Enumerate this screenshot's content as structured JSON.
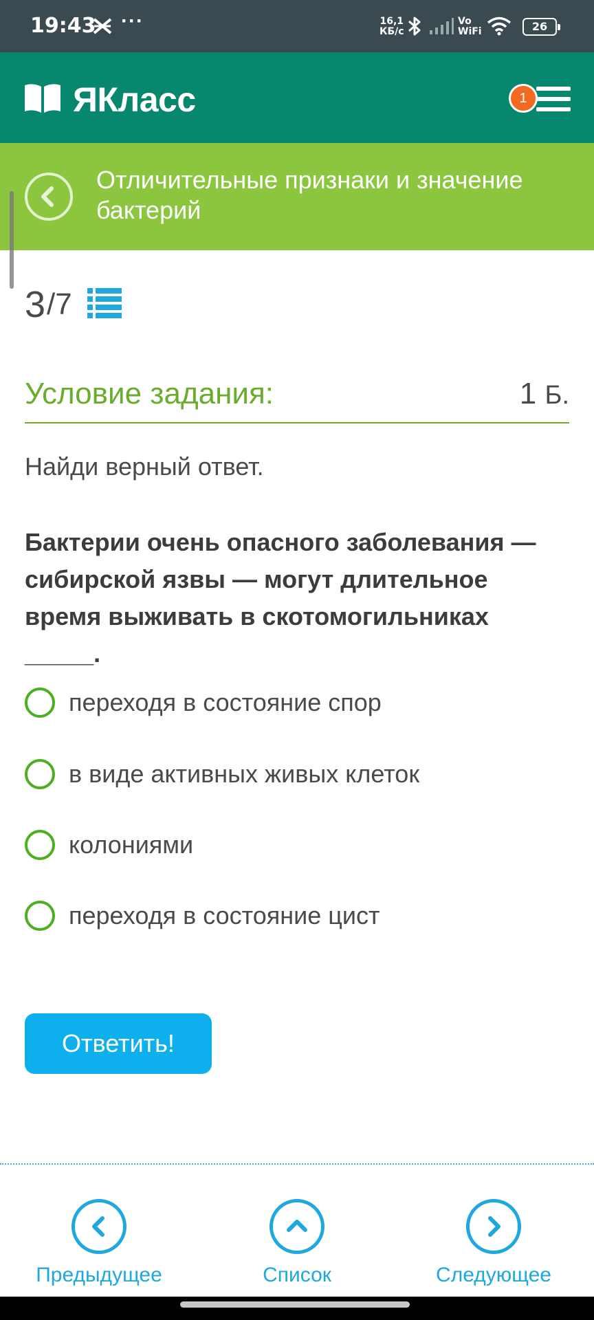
{
  "status_bar": {
    "time": "19:43",
    "dots": "···",
    "speed_value": "16,1",
    "speed_unit": "КБ/с",
    "vo": "Vo",
    "wifi_label": "WiFi",
    "battery": "26"
  },
  "app": {
    "logo_text": "ЯКласс",
    "notification_count": "1"
  },
  "topic": {
    "title": "Отличительные признаки и значение бактерий"
  },
  "progress": {
    "current": "3",
    "separator": "/",
    "total": "7"
  },
  "task": {
    "label": "Условие задания:",
    "points": "1",
    "points_unit": "Б.",
    "instruction": "Найди верный ответ.",
    "question": "Бактерии очень опасного заболевания — сибирской язвы — могут длительное время выживать в скотомогильниках _____.",
    "options": [
      "переходя в состояние спор",
      "в виде активных живых клеток",
      "колониями",
      "переходя в состояние цист"
    ],
    "submit_label": "Ответить!"
  },
  "bottom_nav": {
    "prev": "Предыдущее",
    "list": "Список",
    "next": "Следующее"
  },
  "colors": {
    "status_bar": "#3a4a50",
    "header": "#07876d",
    "topic_bar": "#8cc63f",
    "accent_green": "#6aad2e",
    "accent_blue": "#0db0ec",
    "badge": "#f26a21"
  },
  "icons": [
    "notification-icon",
    "bluetooth-icon",
    "signal-icon",
    "wifi-icon",
    "battery-icon",
    "book-logo-icon",
    "menu-icon",
    "back-icon",
    "list-icon",
    "radio-icon",
    "chevron-left-icon",
    "chevron-up-icon",
    "chevron-right-icon"
  ]
}
